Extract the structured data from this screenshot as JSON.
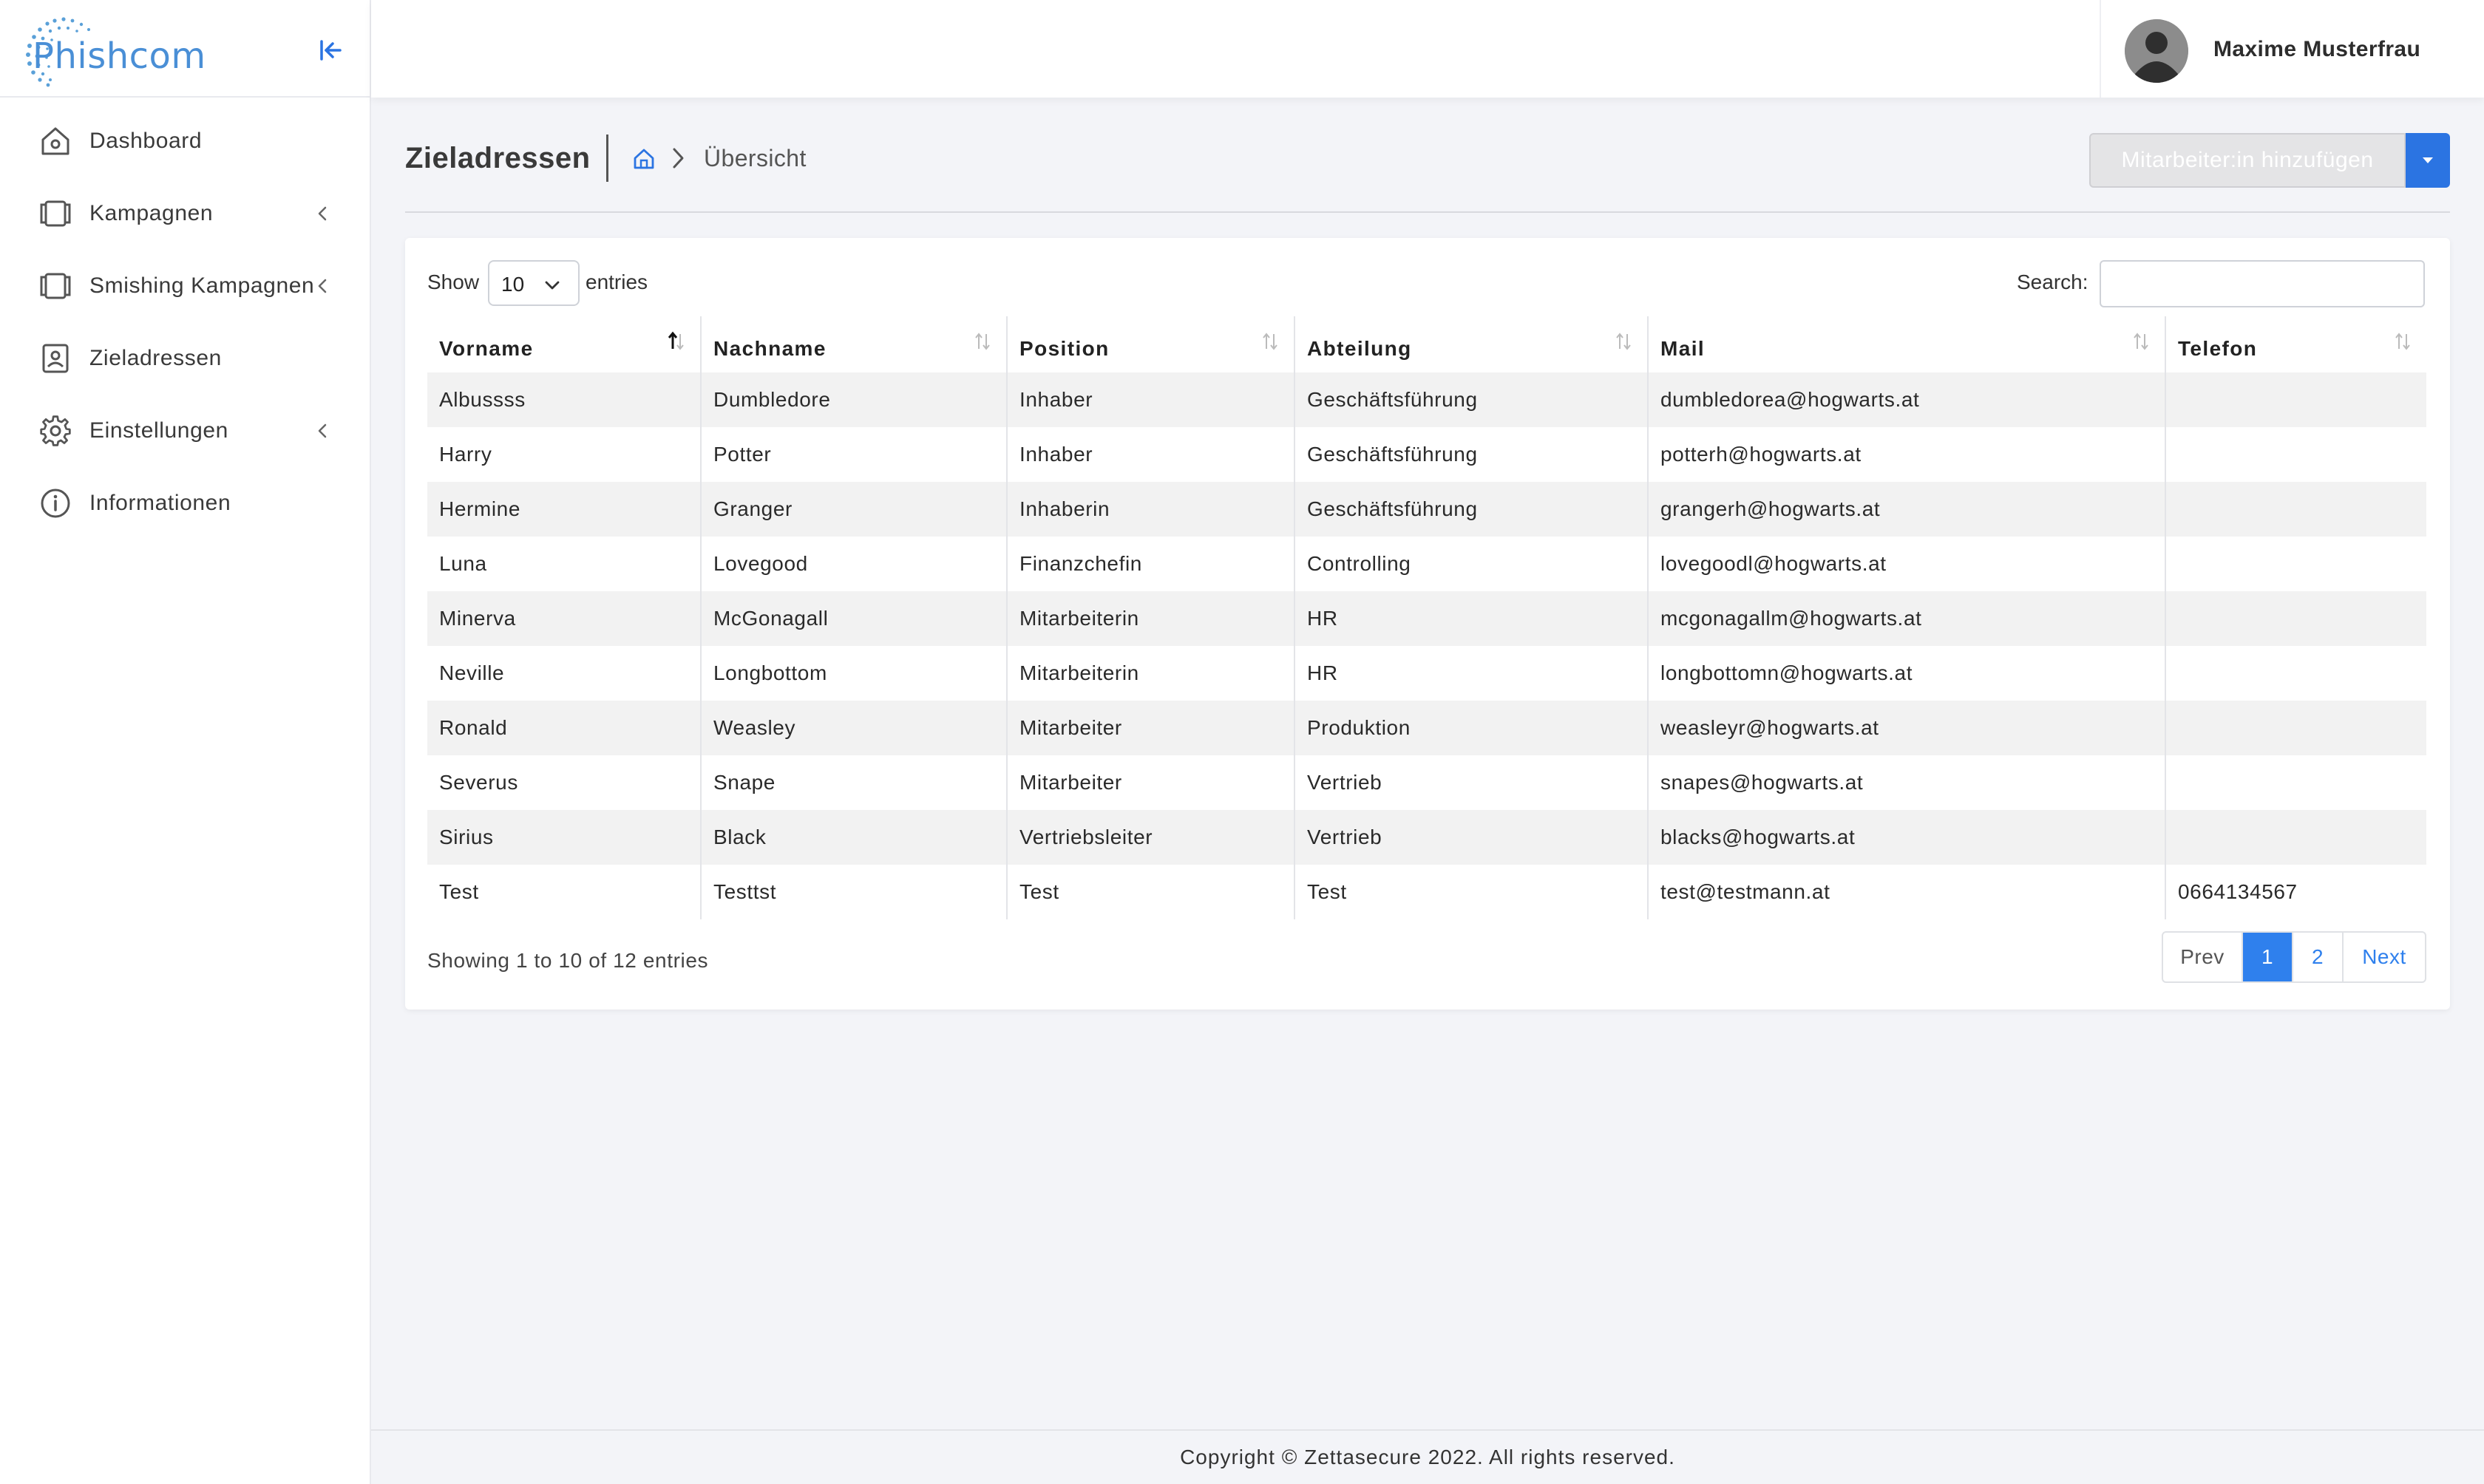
{
  "brand": {
    "name": "Phishcom",
    "accent": "#4a8fd6"
  },
  "sidebar": {
    "items": [
      {
        "label": "Dashboard",
        "icon": "home-icon",
        "has_submenu": false
      },
      {
        "label": "Kampagnen",
        "icon": "campaign-icon",
        "has_submenu": true
      },
      {
        "label": "Smishing Kampagnen",
        "icon": "campaign-icon",
        "has_submenu": true
      },
      {
        "label": "Zieladressen",
        "icon": "contact-icon",
        "has_submenu": false
      },
      {
        "label": "Einstellungen",
        "icon": "gear-icon",
        "has_submenu": true
      },
      {
        "label": "Informationen",
        "icon": "info-icon",
        "has_submenu": false
      }
    ]
  },
  "user": {
    "name": "Maxime Musterfrau"
  },
  "page": {
    "title": "Zieladressen",
    "breadcrumb_current": "Übersicht",
    "add_button": "Mitarbeiter:in hinzufügen"
  },
  "table_controls": {
    "show_label": "Show",
    "page_length": "10",
    "entries_label": "entries",
    "search_label": "Search:",
    "search_value": ""
  },
  "table": {
    "columns": [
      "Vorname",
      "Nachname",
      "Position",
      "Abteilung",
      "Mail",
      "Telefon"
    ],
    "sorted_column": "Vorname",
    "rows": [
      [
        "Albussss",
        "Dumbledore",
        "Inhaber",
        "Geschäftsführung",
        "dumbledorea@hogwarts.at",
        ""
      ],
      [
        "Harry",
        "Potter",
        "Inhaber",
        "Geschäftsführung",
        "potterh@hogwarts.at",
        ""
      ],
      [
        "Hermine",
        "Granger",
        "Inhaberin",
        "Geschäftsführung",
        "grangerh@hogwarts.at",
        ""
      ],
      [
        "Luna",
        "Lovegood",
        "Finanzchefin",
        "Controlling",
        "lovegoodl@hogwarts.at",
        ""
      ],
      [
        "Minerva",
        "McGonagall",
        "Mitarbeiterin",
        "HR",
        "mcgonagallm@hogwarts.at",
        ""
      ],
      [
        "Neville",
        "Longbottom",
        "Mitarbeiterin",
        "HR",
        "longbottomn@hogwarts.at",
        ""
      ],
      [
        "Ronald",
        "Weasley",
        "Mitarbeiter",
        "Produktion",
        "weasleyr@hogwarts.at",
        ""
      ],
      [
        "Severus",
        "Snape",
        "Mitarbeiter",
        "Vertrieb",
        "snapes@hogwarts.at",
        ""
      ],
      [
        "Sirius",
        "Black",
        "Vertriebsleiter",
        "Vertrieb",
        "blacks@hogwarts.at",
        ""
      ],
      [
        "Test",
        "Testtst",
        "Test",
        "Test",
        "test@testmann.at",
        "0664134567"
      ]
    ]
  },
  "pagination": {
    "info": "Showing 1 to 10 of 12 entries",
    "prev": "Prev",
    "pages": [
      "1",
      "2"
    ],
    "current_page": "1",
    "next": "Next",
    "active_color": "#2f80ed"
  },
  "footer": {
    "copyright": "Copyright © Zettasecure 2022. All rights reserved."
  }
}
